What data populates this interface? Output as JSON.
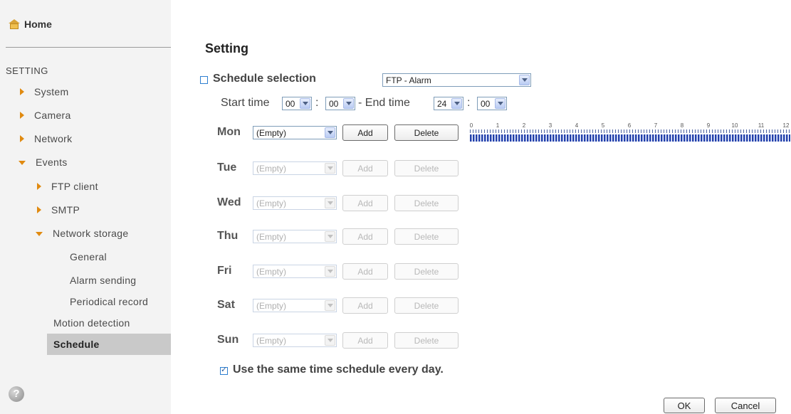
{
  "sidebar": {
    "home_label": "Home",
    "heading": "SETTING",
    "items": [
      {
        "label": "System"
      },
      {
        "label": "Camera"
      },
      {
        "label": "Network"
      },
      {
        "label": "Events"
      },
      {
        "label": "FTP client"
      },
      {
        "label": "SMTP"
      },
      {
        "label": "Network storage"
      },
      {
        "label": "General"
      },
      {
        "label": "Alarm sending"
      },
      {
        "label": "Periodical record"
      },
      {
        "label": "Motion detection"
      },
      {
        "label": "Schedule"
      }
    ],
    "help_glyph": "?"
  },
  "main": {
    "title": "Setting",
    "schedule_selection_label": "Schedule selection",
    "schedule_selection_value": "FTP - Alarm",
    "start_time_label": "Start time",
    "start_hour": "00",
    "start_minute": "00",
    "colon": ":",
    "end_time_label": "- End time",
    "end_hour": "24",
    "end_minute": "00",
    "days": [
      {
        "label": "Mon",
        "value": "(Empty)",
        "add": "Add",
        "delete": "Delete"
      },
      {
        "label": "Tue",
        "value": "(Empty)",
        "add": "Add",
        "delete": "Delete"
      },
      {
        "label": "Wed",
        "value": "(Empty)",
        "add": "Add",
        "delete": "Delete"
      },
      {
        "label": "Thu",
        "value": "(Empty)",
        "add": "Add",
        "delete": "Delete"
      },
      {
        "label": "Fri",
        "value": "(Empty)",
        "add": "Add",
        "delete": "Delete"
      },
      {
        "label": "Sat",
        "value": "(Empty)",
        "add": "Add",
        "delete": "Delete"
      },
      {
        "label": "Sun",
        "value": "(Empty)",
        "add": "Add",
        "delete": "Delete"
      }
    ],
    "timeline_hours": [
      "0",
      "1",
      "2",
      "3",
      "4",
      "5",
      "6",
      "7",
      "8",
      "9",
      "10",
      "11",
      "12"
    ],
    "same_schedule_label": "Use the same time schedule every day.",
    "ok_label": "OK",
    "cancel_label": "Cancel"
  },
  "colors": {
    "accent_triangle": "#e08a10",
    "select_border": "#7f9db9",
    "timeline_blue": "#2340a8"
  }
}
